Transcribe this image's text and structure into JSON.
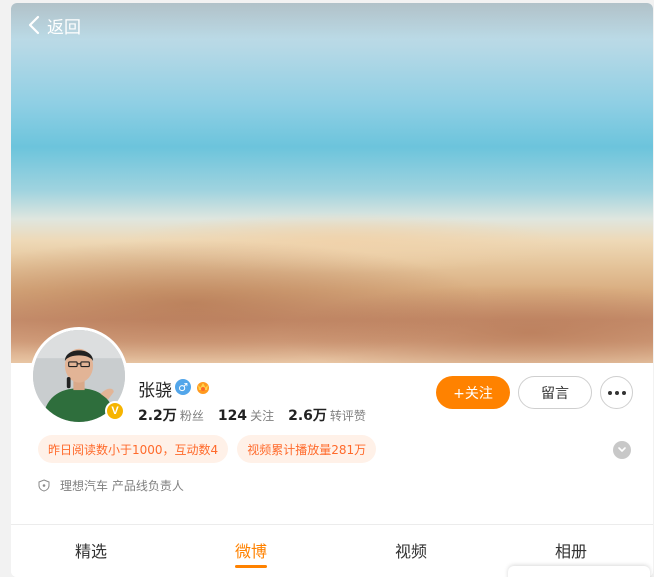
{
  "header": {
    "back_label": "返回"
  },
  "profile": {
    "name": "张骁",
    "gender_symbol": "♂",
    "verified_symbol": "V",
    "stats": [
      {
        "value": "2.2万",
        "label": "粉丝"
      },
      {
        "value": "124",
        "label": "关注"
      },
      {
        "value": "2.6万",
        "label": "转评赞"
      }
    ],
    "tags": [
      "昨日阅读数小于1000，互动数4",
      "视频累计播放量281万"
    ],
    "description": "理想汽车 产品线负责人"
  },
  "actions": {
    "follow_label": "+关注",
    "message_label": "留言"
  },
  "tabs": [
    {
      "label": "精选",
      "active": false
    },
    {
      "label": "微博",
      "active": true
    },
    {
      "label": "视频",
      "active": false
    },
    {
      "label": "相册",
      "active": false
    }
  ],
  "colors": {
    "accent": "#ff8200",
    "tag_text": "#ff6a2b",
    "tag_bg": "#fff1e8",
    "verified": "#f6b400",
    "gender": "#53a6ea"
  }
}
